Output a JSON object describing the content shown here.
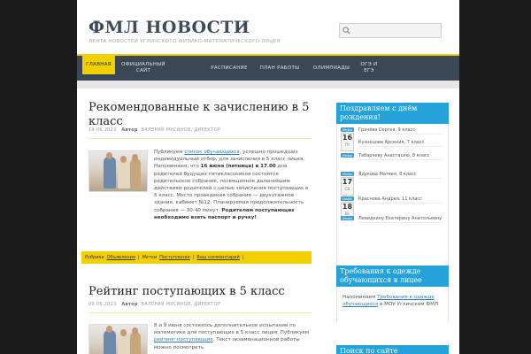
{
  "site": {
    "title": "ФМЛ НОВОСТИ",
    "description": "ЛЕНТА НОВОСТЕЙ УГЛИЧСКОГО ФИЗИКО-МАТЕМАТИЧЕСКОГО ЛИЦЕЯ"
  },
  "search": {
    "placeholder": ""
  },
  "nav": [
    {
      "label": "ГЛАВНАЯ",
      "active": true
    },
    {
      "label": "ОФИЦИАЛЬНЫЙ САЙТ"
    },
    {
      "label": "РАСПИСАНИЕ"
    },
    {
      "label": "ПЛАН РАБОТЫ"
    },
    {
      "label": "ОЛИМПИАДЫ"
    },
    {
      "label": "ОГЭ И ЕГЭ"
    }
  ],
  "posts": [
    {
      "title": "Рекомендованные к зачислению в 5 класс",
      "date": "14.06.2023",
      "author_label": "Автор",
      "author": "ВАЛЕРИЙ МУСИНОВ, ДИРЕКТОР",
      "text_1": "Публикуем ",
      "link": "список обучающихся",
      "text_2": ", успешно прошедших индивидуальный отбор, для зачисления в 5 класс лицея. Напоминаем, что ",
      "bold_1": "16 июня (пятница) в 17.00",
      "text_3": " для родителей будущих пятиклассников состоится родительское собрание, посвященное дальнейшим действиям родителей с целью зачисления поступающих в 5 класс. Место проведения собрания — двухэтажное здание, кабинет №12. Планируемая продолжительность собрания — 30-40 минут. ",
      "bold_2": "Родителям поступающих необходимо взять паспорт и ручку!",
      "rubric_label": "Рубрика",
      "rubric": "Объявления",
      "tags_label": "Метки",
      "tag": "Поступление",
      "comments": "Ваш комментарий"
    },
    {
      "title": "Рейтинг поступающих в 5 класс",
      "date": "09.06.2023",
      "author_label": "Автор",
      "author": "ВАЛЕРИЙ МУСИНОВ, ДИРЕКТОР",
      "text_1": "8 и 9 июня состоялось дополнительное испытание по математике для поступающих в 5 класс лицея. Публикуем ",
      "link": "рейтинг поступающих",
      "text_2": ". Текст экзаменационной работы можно посмотреть"
    }
  ],
  "birthday_widget": {
    "title": "Поздравляем с днём рождения!",
    "events": [
      {
        "badge": "Инфо",
        "day": "16",
        "weekday": "Пт",
        "name": "Грачёва Сергея, 9 класс"
      },
      {
        "badge": "Инфо",
        "name": "Кузнецова Арсения, 7 класс"
      },
      {
        "badge": "Инфо",
        "name": "Табарчеву Анастасию, 8 класс"
      },
      {
        "badge": "Инфо",
        "day": "17",
        "weekday": "Сб",
        "name": "Ядукова Матвея, 8 класс"
      },
      {
        "badge": "Инфо",
        "day": "18",
        "weekday": "Вс",
        "name": "Краснова Андрея, 11 класс"
      },
      {
        "badge": "Инфо",
        "name": "Левидкину Екатерину Анатольевну"
      }
    ]
  },
  "dress_widget": {
    "title": "Требования к одежде обучающихся в лицее",
    "text_1": "Напоминаем ",
    "link": "Требования к одежде обучающихся",
    "text_2": " в МОУ Угличском ФМЛ"
  },
  "search_widget": {
    "title": "Поиск по сайте"
  }
}
